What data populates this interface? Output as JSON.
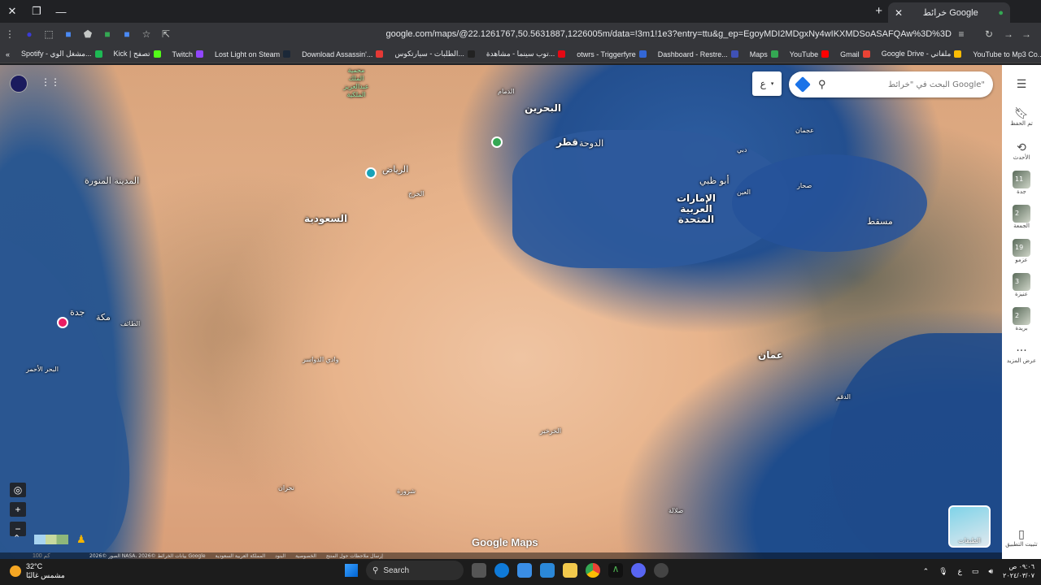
{
  "browser": {
    "tab_title": "خرائط Google",
    "url": "google.com/maps/@22.1261767,50.5631887,1226005m/data=!3m1!1e3?entry=ttu&g_ep=EgoyMDI2MDgxNy4wIKXMDSoASAFQAw%3D%3D",
    "bookmarks": [
      "Spotify - مشغل الوي...",
      "Kick | تصفح",
      "Twitch",
      "Lost Light on Steam",
      "Download Assassin'...",
      "الطلبات - سيارتكوس...",
      "توب سينما - مشاهدة...",
      "otwrs - Triggerfyre",
      "Dashboard - Restre...",
      "Maps",
      "YouTube",
      "Gmail",
      "Google Drive - ملفاتي",
      "YouTube to Mp3 Co..."
    ],
    "bookmark_colors": [
      "#1db954",
      "#53fc18",
      "#9146ff",
      "#1b2838",
      "#e53935",
      "#222222",
      "#e50914",
      "#3367d6",
      "#3f51b5",
      "#34a853",
      "#ff0000",
      "#ea4335",
      "#fbbc04",
      "#1565c0"
    ]
  },
  "maps": {
    "search_placeholder": "البحث في \"خرائط Google\"",
    "lang_button": "ع",
    "logo": "Google Maps",
    "layers_label": "الطبقات",
    "scale": "100 كم",
    "footer": [
      "الصور ©2026 NASA، بيانات الخرائط ©2026 Google",
      "المملكة العربية السعودية",
      "البنود",
      "الخصوصية",
      "إرسال ملاحظات حول المنتج"
    ],
    "place_labels": {
      "bahrain": "البحرين",
      "qatar": "قطر",
      "doha": "الدوحة",
      "riyadh": "الرياض",
      "saudi": "السعودية",
      "uae": "الإمارات العربية المتحدة",
      "abudhabi": "أبو ظبي",
      "oman": "عمان",
      "muscat": "مسقط",
      "madinah": "المدينة المنورة",
      "makkah": "مكة",
      "jeddah": "جدة",
      "redsea": "البحر الأحمر",
      "dammam": "الدمام",
      "sharurah": "شرورة",
      "taif": "الطائف",
      "dubai": "دبي",
      "ajman": "عجمان",
      "alain": "العين",
      "sohar": "صحار",
      "duqm": "الدقم",
      "salalah": "صلالة",
      "kharkhir": "الخرخير",
      "wadi_dawasir": "وادي الدواسر",
      "najran": "نجران",
      "alkharj": "الخرج"
    },
    "side": {
      "menu_icon": "hamburger-icon",
      "saved": "تم الحفظ",
      "recent": "الأحدث",
      "recents": [
        {
          "label": "جدة",
          "badge": "11"
        },
        {
          "label": "الجمعة",
          "badge": "2"
        },
        {
          "label": "عزمو",
          "badge": "19"
        },
        {
          "label": "عنيزة",
          "badge": "3"
        },
        {
          "label": "بريدة",
          "badge": "2"
        }
      ],
      "more": "عرض المزيد",
      "install": "تثبيت التطبيق"
    }
  },
  "taskbar": {
    "weather_temp": "32°C",
    "weather_desc": "مشمس غالبًا",
    "search": "Search",
    "time": "٠٩:٠٦ ص",
    "date": "٢٠٢٤/٠٣/٠٧",
    "lang": "ع"
  }
}
